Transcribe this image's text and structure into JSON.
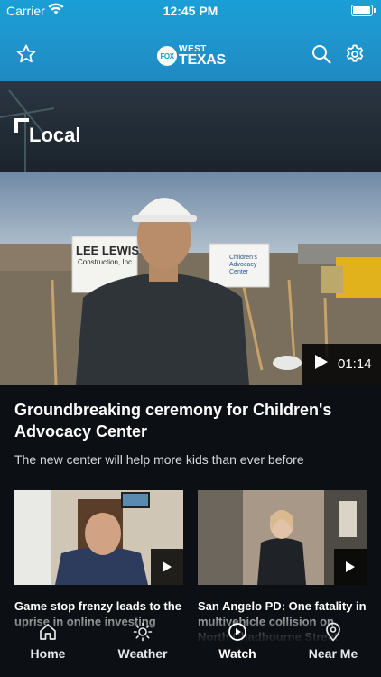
{
  "status_bar": {
    "carrier": "Carrier",
    "time": "12:45 PM"
  },
  "header": {
    "logo_badge": "FOX",
    "logo_line1": "WEST",
    "logo_line2": "TEXAS",
    "left_icon": "star-icon",
    "right_icons": [
      "search-icon",
      "gear-icon"
    ]
  },
  "section": {
    "title": "Local"
  },
  "hero": {
    "duration": "01:14",
    "headline": "Groundbreaking ceremony for Children's Advocacy Center",
    "subhead": "The new center will help more kids than ever before",
    "sign_text_1": "LEE LEWIS",
    "sign_text_2": "Construction, Inc.",
    "sign_text_3": "Children's Advocacy Center"
  },
  "cards": [
    {
      "title": "Game stop frenzy leads to the uprise in online investing"
    },
    {
      "title": "San Angelo PD: One fatality in multivehicle collision on North Chadbourne Street"
    }
  ],
  "tabs": [
    {
      "label": "Home",
      "icon": "home-icon",
      "active": false
    },
    {
      "label": "Weather",
      "icon": "sun-icon",
      "active": false
    },
    {
      "label": "Watch",
      "icon": "play-circle-icon",
      "active": true
    },
    {
      "label": "Near Me",
      "icon": "location-pin-icon",
      "active": false
    }
  ],
  "colors": {
    "header_blue": "#1f97cf",
    "background": "#0c0f14"
  }
}
